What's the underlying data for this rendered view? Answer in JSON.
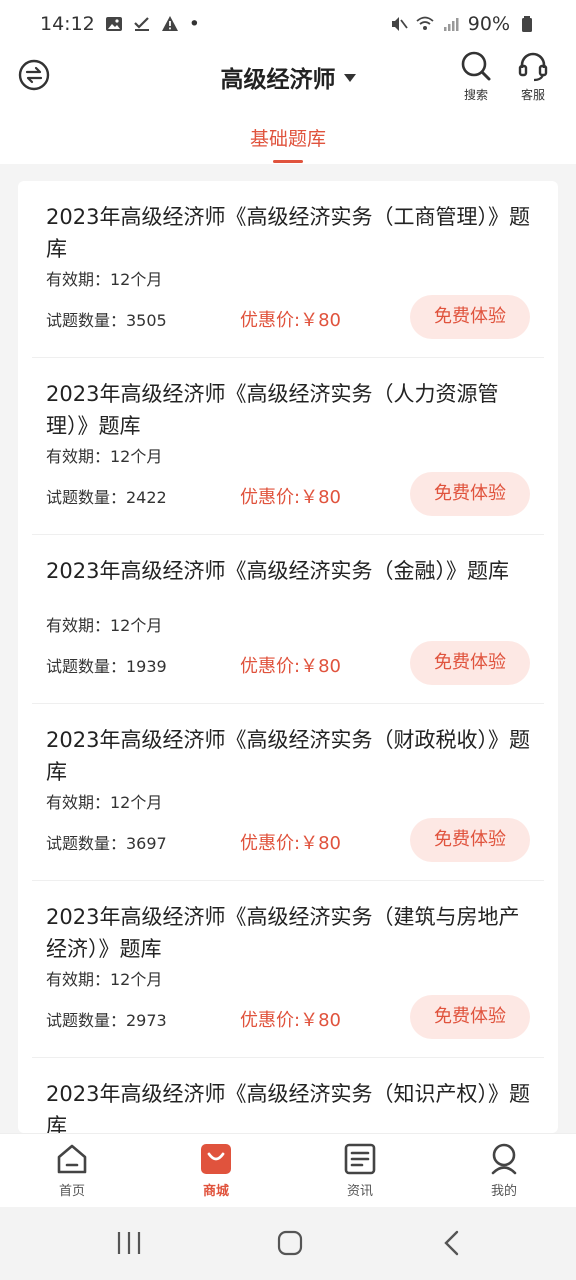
{
  "status_bar": {
    "time": "14:12",
    "battery": "90%",
    "dot": "•"
  },
  "header": {
    "title": "高级经济师",
    "search_label": "搜索",
    "service_label": "客服"
  },
  "tabs": [
    {
      "label": "基础题库",
      "active": true
    }
  ],
  "products": [
    {
      "title": "2023年高级经济师《高级经济实务（工商管理）》题库",
      "validity": "有效期：12个月",
      "count": "试题数量：3505",
      "price": "优惠价:￥80",
      "button": "免费体验"
    },
    {
      "title": "2023年高级经济师《高级经济实务（人力资源管理）》题库",
      "validity": "有效期：12个月",
      "count": "试题数量：2422",
      "price": "优惠价:￥80",
      "button": "免费体验"
    },
    {
      "title": "2023年高级经济师《高级经济实务（金融）》题库",
      "validity": "有效期：12个月",
      "count": "试题数量：1939",
      "price": "优惠价:￥80",
      "button": "免费体验"
    },
    {
      "title": "2023年高级经济师《高级经济实务（财政税收）》题库",
      "validity": "有效期：12个月",
      "count": "试题数量：3697",
      "price": "优惠价:￥80",
      "button": "免费体验"
    },
    {
      "title": "2023年高级经济师《高级经济实务（建筑与房地产经济）》题库",
      "validity": "有效期：12个月",
      "count": "试题数量：2973",
      "price": "优惠价:￥80",
      "button": "免费体验"
    },
    {
      "title": "2023年高级经济师《高级经济实务（知识产权）》题库",
      "validity": "",
      "count": "",
      "price": "",
      "button": ""
    }
  ],
  "bottom_nav": [
    {
      "label": "首页",
      "icon": "home-icon"
    },
    {
      "label": "商城",
      "icon": "shop-bag-icon",
      "active": true
    },
    {
      "label": "资讯",
      "icon": "news-icon"
    },
    {
      "label": "我的",
      "icon": "profile-icon"
    }
  ],
  "colors": {
    "accent": "#e0533d",
    "button_bg": "#fde8e4",
    "page_bg": "#f4f4f4"
  }
}
